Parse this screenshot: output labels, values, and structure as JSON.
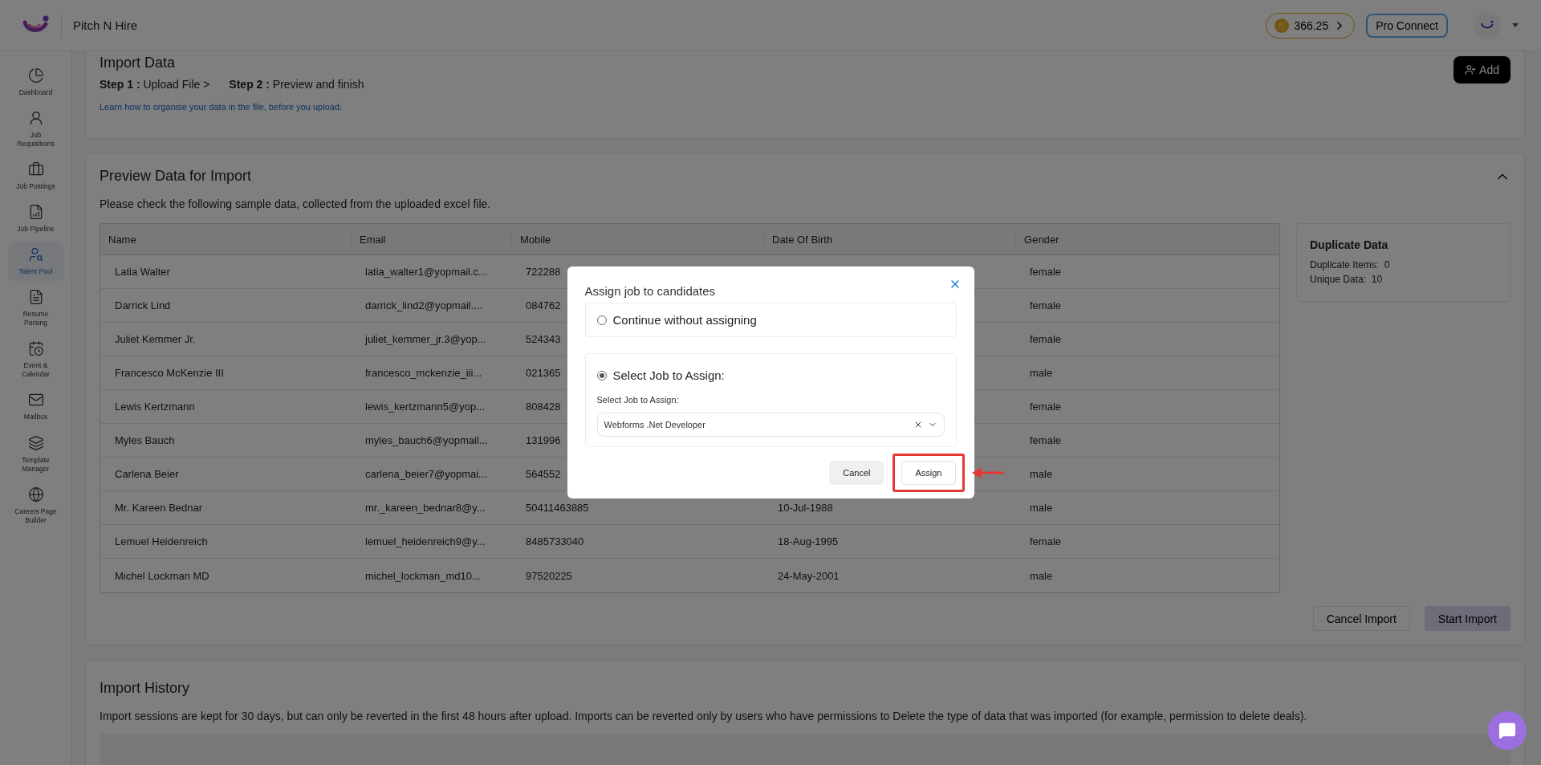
{
  "header": {
    "brand": "Pitch N Hire",
    "credits": "366.25",
    "pro_button": "Pro Connect"
  },
  "sidebar": {
    "items": [
      {
        "label": "Dashboard",
        "selected": false
      },
      {
        "label": "Job Requisitions",
        "selected": false
      },
      {
        "label": "Job Postings",
        "selected": false
      },
      {
        "label": "Job Pipeline",
        "selected": false
      },
      {
        "label": "Talent Pool",
        "selected": true
      },
      {
        "label": "Resume Parsing",
        "selected": false
      },
      {
        "label": "Event & Calendar",
        "selected": false
      },
      {
        "label": "Mailbox",
        "selected": false
      },
      {
        "label": "Template Manager",
        "selected": false
      },
      {
        "label": "Careers Page Builder",
        "selected": false
      }
    ]
  },
  "import_data": {
    "title": "Import Data",
    "steps": [
      {
        "label": "Step 1 :",
        "text": "Upload File >"
      },
      {
        "label": "Step 2 :",
        "text": "Preview and finish"
      }
    ],
    "link": "Learn how to organise your data in the file, before you upload.",
    "add_button": "Add"
  },
  "preview": {
    "title": "Preview Data for Import",
    "expanded": true,
    "description": "Please check the following sample data, collected from the uploaded excel file.",
    "table": {
      "columns": [
        "Name",
        "Email",
        "Mobile",
        "Date Of Birth",
        "Gender"
      ],
      "rows": [
        {
          "name": "Latia Walter",
          "email": "latia_walter1@yopmail.c...",
          "mobile": "722288",
          "gender": "female"
        },
        {
          "name": "Darrick Lind",
          "email": "darrick_lind2@yopmail....",
          "mobile": "084762",
          "gender": "female"
        },
        {
          "name": "Juliet Kemmer Jr.",
          "email": "juliet_kemmer_jr.3@yop...",
          "mobile": "524343",
          "gender": "female"
        },
        {
          "name": "Francesco McKenzie III",
          "email": "francesco_mckenzie_iii...",
          "mobile": "021365",
          "gender": "male"
        },
        {
          "name": "Lewis Kertzmann",
          "email": "lewis_kertzmann5@yop...",
          "mobile": "808428",
          "gender": "female"
        },
        {
          "name": "Myles Bauch",
          "email": "myles_bauch6@yopmail...",
          "mobile": "131996",
          "gender": "female"
        },
        {
          "name": "Carlena Beier",
          "email": "carlena_beier7@yopmai...",
          "mobile": "564552",
          "gender": "male"
        },
        {
          "name": "Mr. Kareen Bednar",
          "email": "mr._kareen_bednar8@y...",
          "mobile": "50411463885",
          "date_of_birth": "10-Jul-1988",
          "gender": "male"
        },
        {
          "name": "Lemuel Heidenreich",
          "email": "lemuel_heidenreich9@y...",
          "mobile": "8485733040",
          "date_of_birth": "18-Aug-1995",
          "gender": "female"
        },
        {
          "name": "Michel Lockman MD",
          "email": "michel_lockman_md10...",
          "mobile": "97520225",
          "date_of_birth": "24-May-2001",
          "gender": "male"
        }
      ]
    },
    "duplicate": {
      "title": "Duplicate Data",
      "items": [
        {
          "label": "Duplicate Items:",
          "value": "0"
        },
        {
          "label": "Unique Data:",
          "value": "10"
        }
      ]
    },
    "buttons": [
      {
        "label": "Cancel Import",
        "kind": "secondary"
      },
      {
        "label": "Start Import",
        "kind": "primary"
      }
    ]
  },
  "history": {
    "title": "Import History",
    "text": "Import sessions are kept for 30 days, but can only be reverted in the first 48 hours after upload. Imports can be reverted only by users who have permissions to Delete the type of data that was imported (for example, permission to delete deals)."
  },
  "dialog": {
    "title": "Assign job to candidates",
    "options": [
      {
        "label": "Continue without assigning",
        "selected": false
      },
      {
        "label": "Select Job to Assign:",
        "selected": true,
        "field_label": "Select Job to Assign:",
        "value": "Webforms .Net Developer"
      }
    ],
    "buttons": [
      {
        "label": "Cancel",
        "kind": "secondary",
        "highlighted": false
      },
      {
        "label": "Assign",
        "kind": "primary",
        "highlighted": true
      }
    ]
  }
}
